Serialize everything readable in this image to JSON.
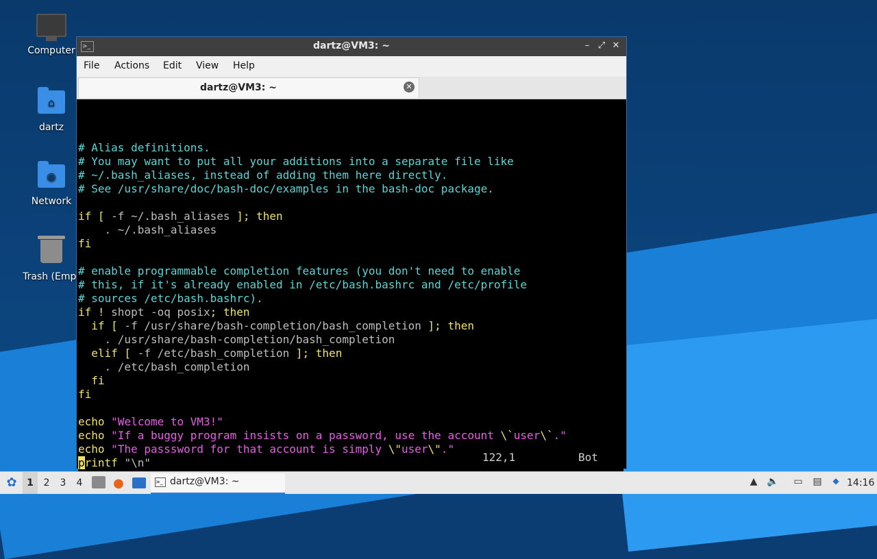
{
  "desktop": {
    "icons": [
      {
        "label": "Computer"
      },
      {
        "label": "dartz"
      },
      {
        "label": "Network"
      },
      {
        "label": "Trash (Empt"
      }
    ]
  },
  "window": {
    "title": "dartz@VM3: ~",
    "controls": {
      "minimize": "–",
      "maximize": "⤢",
      "close": "✕"
    },
    "menu": [
      "File",
      "Actions",
      "Edit",
      "View",
      "Help"
    ],
    "tab": {
      "label": "dartz@VM3: ~",
      "close": "✕"
    }
  },
  "terminal": {
    "lines": [
      {
        "t": "cm",
        "s": "# Alias definitions."
      },
      {
        "t": "cm",
        "s": "# You may want to put all your additions into a separate file like"
      },
      {
        "t": "cm",
        "s": "# ~/.bash_aliases, instead of adding them here directly."
      },
      {
        "t": "cm",
        "s": "# See /usr/share/doc/bash-doc/examples in the bash-doc package."
      },
      {
        "t": "blank",
        "s": ""
      },
      {
        "t": "mix",
        "parts": [
          [
            "kw",
            "if ["
          ],
          [
            "dim",
            " -f ~/.bash_aliases "
          ],
          [
            "kw",
            "]; then"
          ]
        ]
      },
      {
        "t": "dim",
        "s": "    . ~/.bash_aliases"
      },
      {
        "t": "kw",
        "s": "fi"
      },
      {
        "t": "blank",
        "s": ""
      },
      {
        "t": "cm",
        "s": "# enable programmable completion features (you don't need to enable"
      },
      {
        "t": "cm",
        "s": "# this, if it's already enabled in /etc/bash.bashrc and /etc/profile"
      },
      {
        "t": "cm",
        "s": "# sources /etc/bash.bashrc)."
      },
      {
        "t": "mix",
        "parts": [
          [
            "kw",
            "if ! "
          ],
          [
            "dim",
            "shopt -oq posix"
          ],
          [
            "kw",
            "; then"
          ]
        ]
      },
      {
        "t": "mix",
        "parts": [
          [
            "kw",
            "  if ["
          ],
          [
            "dim",
            " -f /usr/share/bash-completion/bash_completion "
          ],
          [
            "kw",
            "]; then"
          ]
        ]
      },
      {
        "t": "dim",
        "s": "    . /usr/share/bash-completion/bash_completion"
      },
      {
        "t": "mix",
        "parts": [
          [
            "kw",
            "  elif ["
          ],
          [
            "dim",
            " -f /etc/bash_completion "
          ],
          [
            "kw",
            "]; then"
          ]
        ]
      },
      {
        "t": "dim",
        "s": "    . /etc/bash_completion"
      },
      {
        "t": "kw",
        "s": "  fi"
      },
      {
        "t": "kw",
        "s": "fi"
      },
      {
        "t": "blank",
        "s": ""
      },
      {
        "t": "mix",
        "parts": [
          [
            "kw",
            "echo "
          ],
          [
            "str",
            "\"Welcome to VM3!\""
          ]
        ]
      },
      {
        "t": "mix",
        "parts": [
          [
            "kw",
            "echo "
          ],
          [
            "str",
            "\"If a buggy program insists on a password, use the account "
          ],
          [
            "kw",
            "\\`"
          ],
          [
            "str",
            "user"
          ],
          [
            "kw",
            "\\`"
          ],
          [
            "str",
            ".\""
          ]
        ]
      },
      {
        "t": "mix",
        "parts": [
          [
            "kw",
            "echo "
          ],
          [
            "str",
            "\"The passsword for that account is simply "
          ],
          [
            "kw",
            "\\\""
          ],
          [
            "str",
            "user"
          ],
          [
            "kw",
            "\\\""
          ],
          [
            "str",
            ".\""
          ]
        ]
      },
      {
        "t": "cursor",
        "parts": [
          [
            "cur",
            "p"
          ],
          [
            "kw",
            "rintf "
          ],
          [
            "dim",
            "\"\\n\""
          ]
        ]
      }
    ],
    "status_position": "122,1",
    "status_scroll": "Bot"
  },
  "taskbar": {
    "workspaces": [
      "1",
      "2",
      "3",
      "4"
    ],
    "active_workspace": "1",
    "task_label": "dartz@VM3: ~",
    "clock": "14:16"
  }
}
